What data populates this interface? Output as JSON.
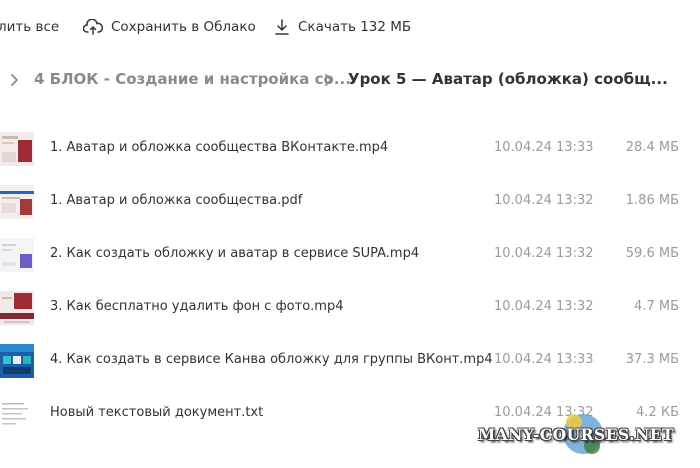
{
  "toolbar": {
    "select_all": "лить все",
    "save_to_cloud": "Сохранить в Облако",
    "download": "Скачать 132 МБ"
  },
  "breadcrumb": {
    "parent": "4 БЛОК - Создание и настройка со...",
    "current": "Урок 5 — Аватар (обложка) сообщ..."
  },
  "files": [
    {
      "name": "1. Аватар и обложка сообщества ВКонтакте.mp4",
      "date": "10.04.24 13:33",
      "size": "28.4 МБ",
      "thumb": "video-thumb"
    },
    {
      "name": "1. Аватар и обложка сообщества.pdf",
      "date": "10.04.24 13:32",
      "size": "1.86 МБ",
      "thumb": "pdf-thumb"
    },
    {
      "name": "2. Как создать обложку и аватар в сервисе SUPA.mp4",
      "date": "10.04.24 13:32",
      "size": "59.6 МБ",
      "thumb": "video-thumb"
    },
    {
      "name": "3. Как бесплатно удалить фон с фото.mp4",
      "date": "10.04.24 13:32",
      "size": "4.7 МБ",
      "thumb": "video-thumb"
    },
    {
      "name": "4. Как создать в сервисе Канва обложку для группы ВКонт.mp4",
      "date": "10.04.24 13:33",
      "size": "37.3 МБ",
      "thumb": "video-thumb"
    },
    {
      "name": "Новый текстовый документ.txt",
      "date": "10.04.24 13:32",
      "size": "4.2 КБ",
      "thumb": "text-thumb"
    }
  ],
  "watermark": "MANY-COURSES.NET"
}
